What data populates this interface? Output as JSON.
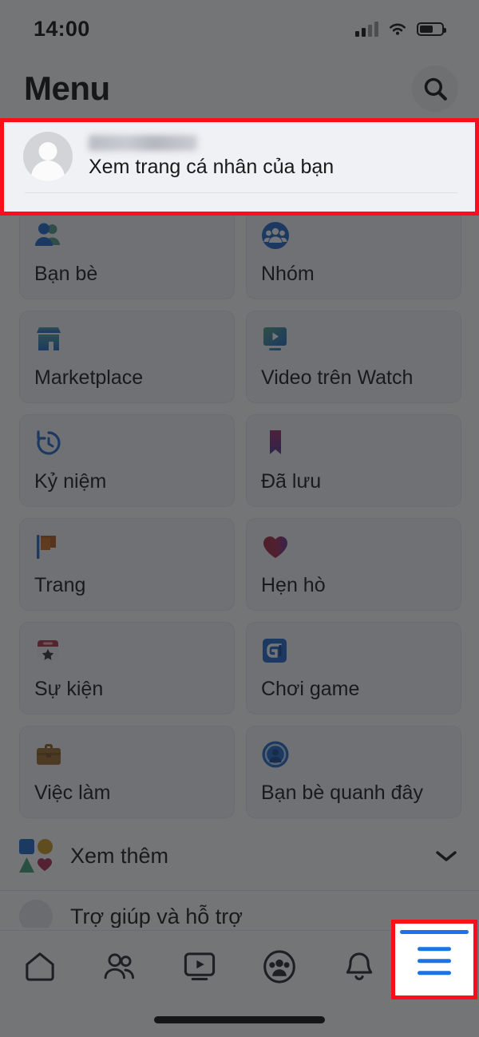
{
  "status_bar": {
    "time": "14:00",
    "signal_icon": "cellular-signal-icon",
    "wifi_icon": "wifi-icon",
    "battery_icon": "battery-icon"
  },
  "header": {
    "title": "Menu",
    "search_icon": "search-icon"
  },
  "profile": {
    "name": "",
    "subtitle": "Xem trang cá nhân của bạn",
    "avatar_icon": "avatar-placeholder-icon"
  },
  "menu_tiles": [
    {
      "label": "Bạn bè",
      "icon": "friends-icon"
    },
    {
      "label": "Nhóm",
      "icon": "groups-icon"
    },
    {
      "label": "Marketplace",
      "icon": "marketplace-icon"
    },
    {
      "label": "Video trên Watch",
      "icon": "watch-video-icon"
    },
    {
      "label": "Kỷ niệm",
      "icon": "memories-clock-icon"
    },
    {
      "label": "Đã lưu",
      "icon": "saved-bookmark-icon"
    },
    {
      "label": "Trang",
      "icon": "pages-flag-icon"
    },
    {
      "label": "Hẹn hò",
      "icon": "dating-heart-icon"
    },
    {
      "label": "Sự kiện",
      "icon": "events-calendar-icon"
    },
    {
      "label": "Chơi game",
      "icon": "gaming-icon"
    },
    {
      "label": "Việc làm",
      "icon": "jobs-briefcase-icon"
    },
    {
      "label": "Bạn bè quanh đây",
      "icon": "nearby-friends-radar-icon"
    }
  ],
  "see_more": {
    "label": "Xem thêm",
    "icon": "shapes-icon",
    "chevron_icon": "chevron-down-icon"
  },
  "partial_row": {
    "label": "Trợ giúp và hỗ trợ",
    "icon": "help-support-icon"
  },
  "bottom_nav": {
    "tabs": [
      {
        "name": "home",
        "icon": "home-icon",
        "active": false
      },
      {
        "name": "friends",
        "icon": "friends-nav-icon",
        "active": false
      },
      {
        "name": "watch",
        "icon": "watch-nav-icon",
        "active": false
      },
      {
        "name": "groups",
        "icon": "groups-nav-icon",
        "active": false
      },
      {
        "name": "notifications",
        "icon": "bell-icon",
        "active": false
      },
      {
        "name": "menu",
        "icon": "hamburger-menu-icon",
        "active": true
      }
    ]
  },
  "annotations": {
    "highlight_color": "#fb0d1b",
    "boxes": [
      {
        "name": "profile-row-highlight"
      },
      {
        "name": "menu-tab-highlight"
      }
    ]
  },
  "colors": {
    "accent_blue": "#1b74e4",
    "tile_bg": "#f3f4f6",
    "profile_bg": "#eff1f4",
    "dim_overlay": "rgba(30,32,36,0.62)"
  }
}
